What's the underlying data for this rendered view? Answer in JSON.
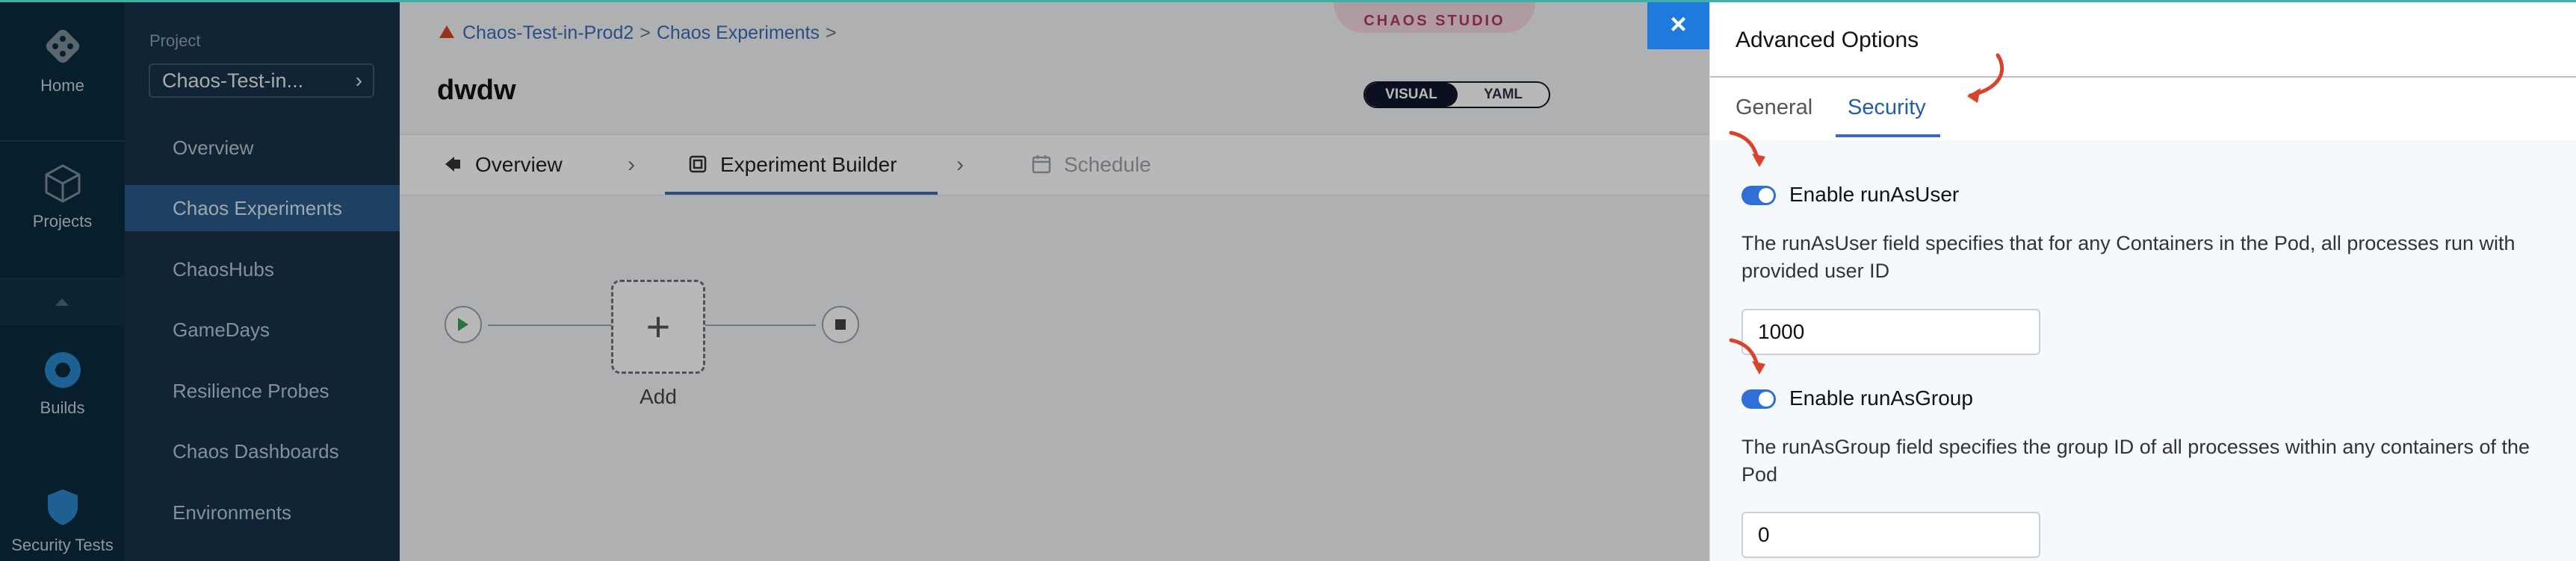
{
  "rail": {
    "items": [
      {
        "label": "Home"
      },
      {
        "label": "Projects"
      },
      {
        "label": "Builds"
      },
      {
        "label": "Security Tests"
      }
    ]
  },
  "sidebar": {
    "project_label": "Project",
    "project_name": "Chaos-Test-in...",
    "items": [
      {
        "label": "Overview"
      },
      {
        "label": "Chaos Experiments",
        "active": true
      },
      {
        "label": "ChaosHubs"
      },
      {
        "label": "GameDays"
      },
      {
        "label": "Resilience Probes"
      },
      {
        "label": "Chaos Dashboards"
      },
      {
        "label": "Environments"
      }
    ]
  },
  "main": {
    "breadcrumb": [
      "Chaos-Test-in-Prod2",
      "Chaos Experiments"
    ],
    "studio_badge": "CHAOS STUDIO",
    "title": "dwdw",
    "view_toggle": {
      "visual": "VISUAL",
      "yaml": "YAML",
      "selected": "VISUAL"
    },
    "steps": [
      {
        "label": "Overview"
      },
      {
        "label": "Experiment Builder",
        "active": true
      },
      {
        "label": "Schedule",
        "disabled": true
      }
    ],
    "canvas": {
      "add_label": "Add",
      "add_symbol": "+"
    }
  },
  "drawer": {
    "close_symbol": "×",
    "title": "Advanced Options",
    "tabs": [
      {
        "label": "General"
      },
      {
        "label": "Security",
        "active": true
      }
    ],
    "run_as_user": {
      "toggle_label": "Enable runAsUser",
      "enabled": true,
      "description": "The runAsUser field specifies that for any Containers in the Pod, all processes run with provided user ID",
      "value": "1000"
    },
    "run_as_group": {
      "toggle_label": "Enable runAsGroup",
      "enabled": true,
      "description": "The runAsGroup field specifies the group ID of all processes within any containers of the Pod",
      "value": "0"
    }
  },
  "colors": {
    "accent": "#2f6fd6",
    "annotation_arrow": "#d9432b",
    "rail_bg": "#0b2a3d",
    "sidebar_bg": "#17324a"
  }
}
